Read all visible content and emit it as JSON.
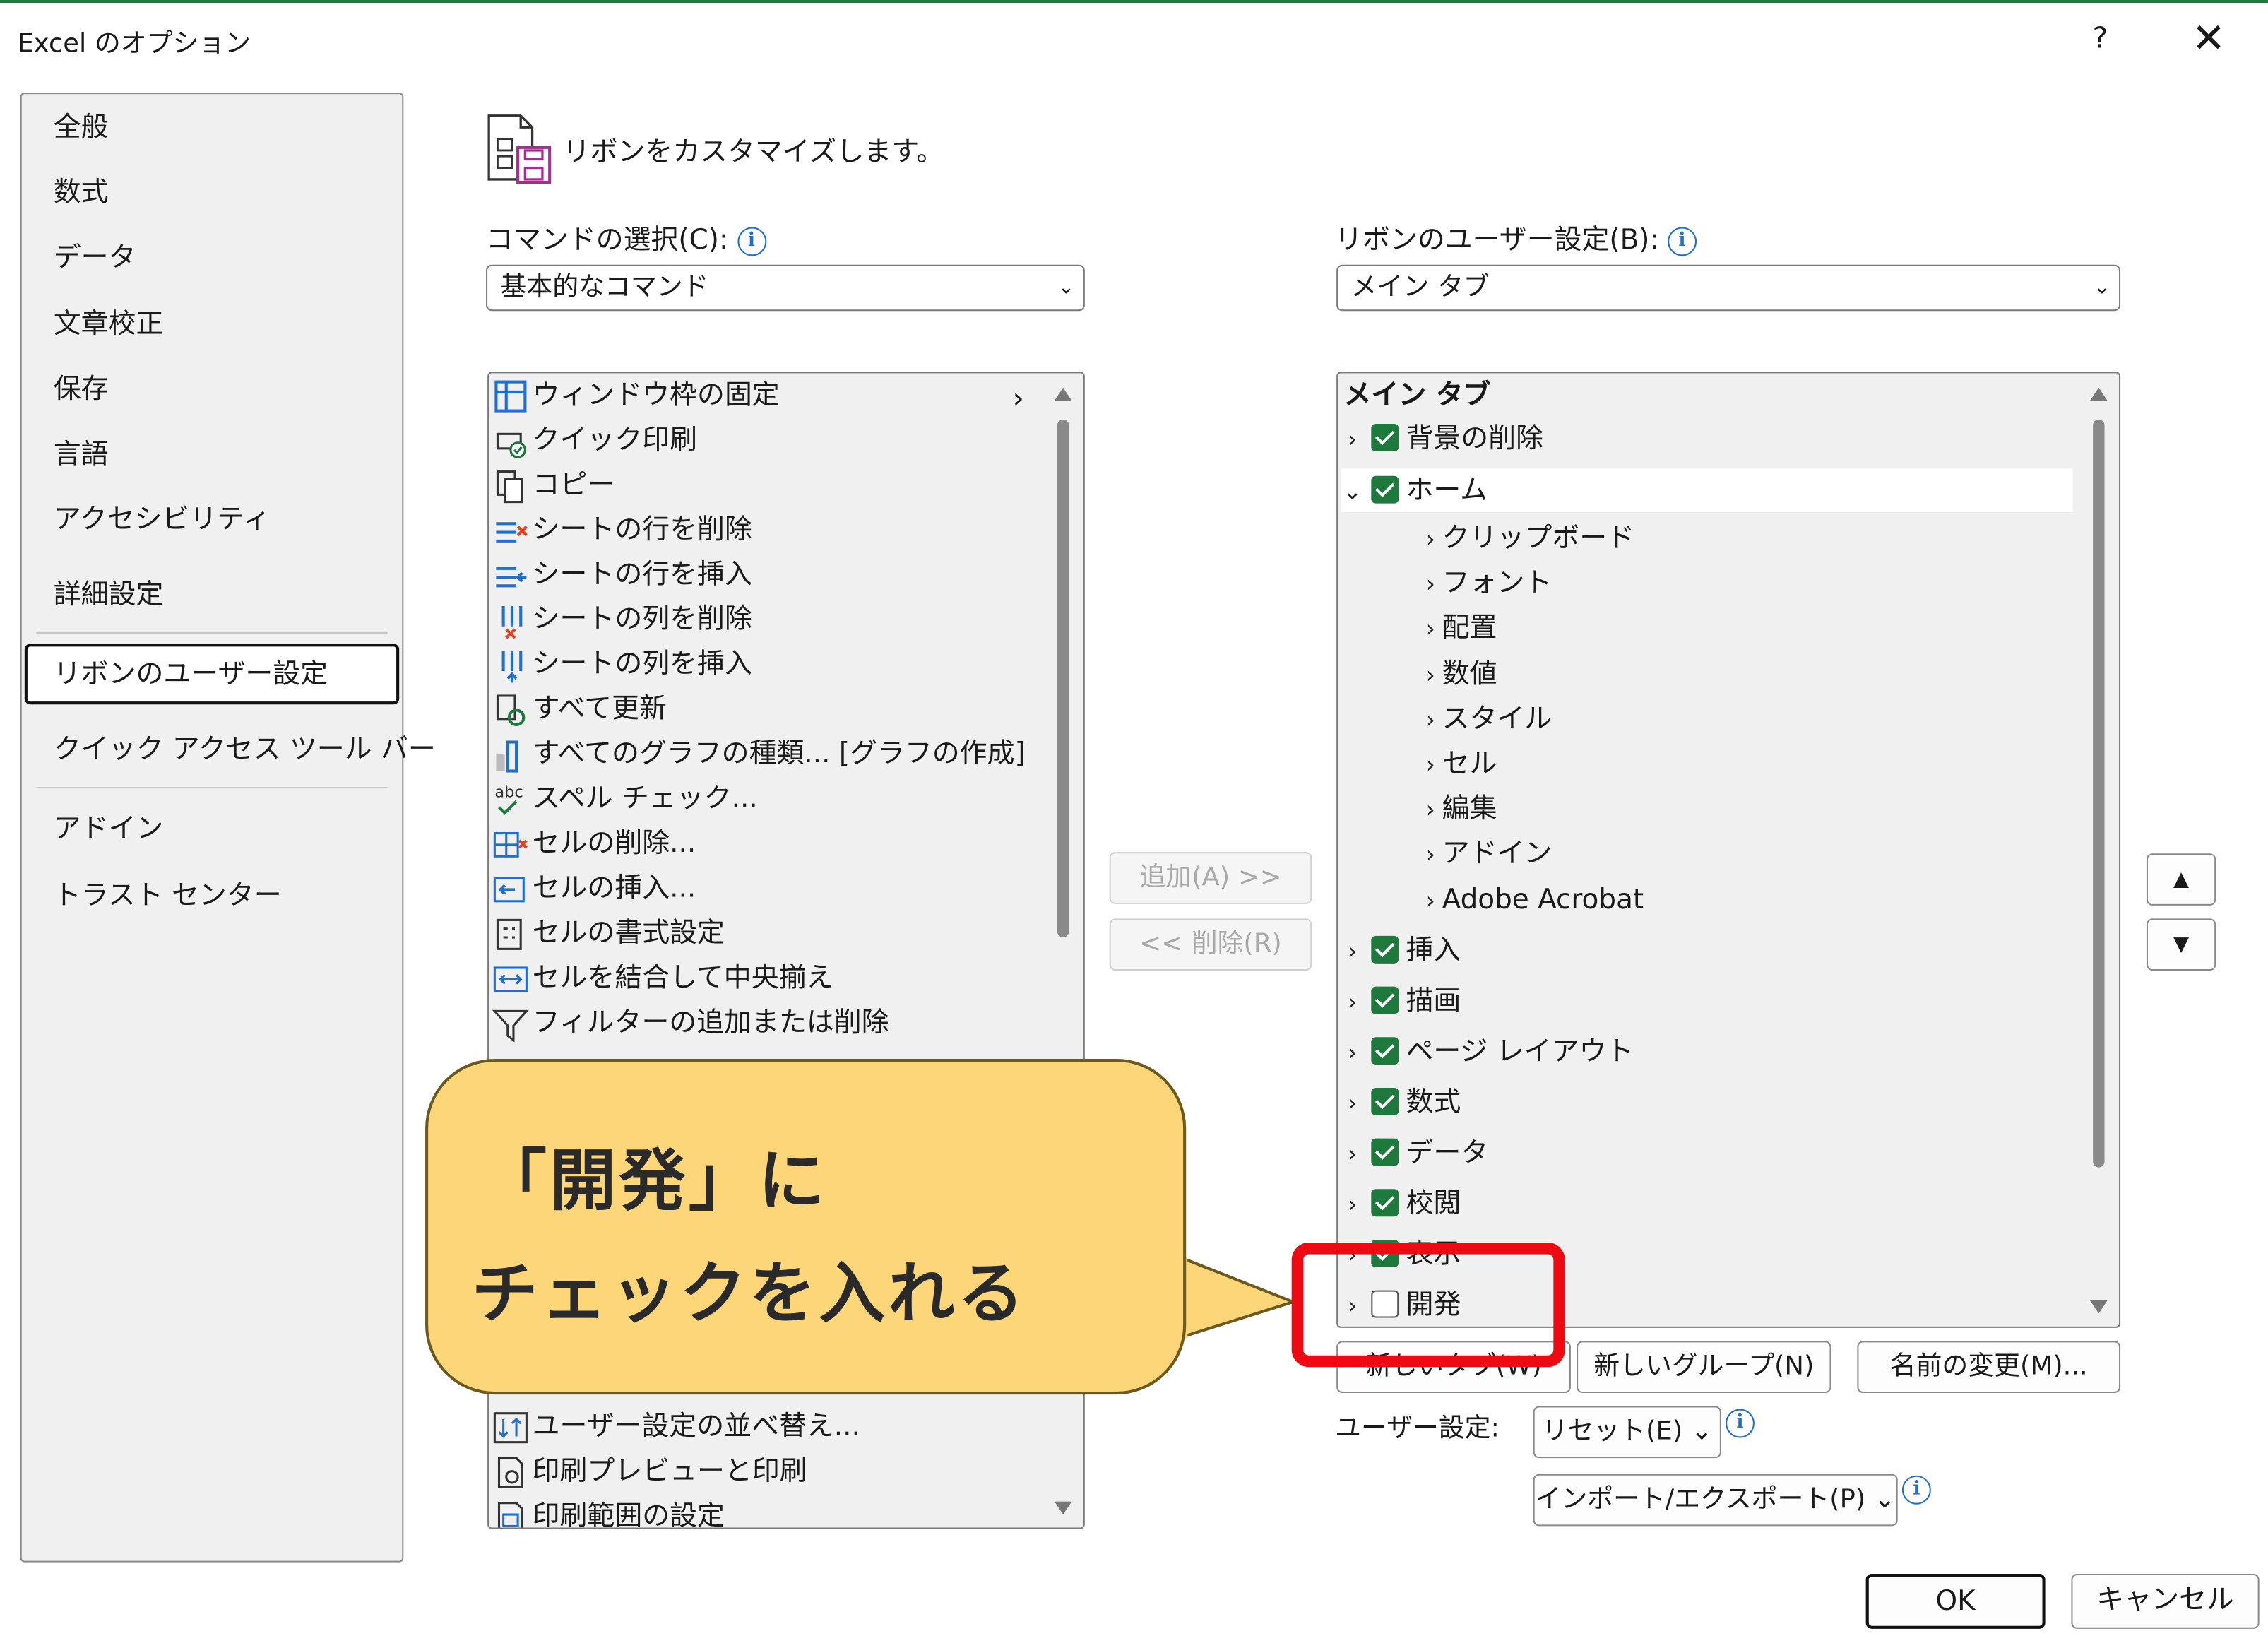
{
  "window": {
    "title": "Excel のオプション",
    "help": "?",
    "close": "✕"
  },
  "nav": {
    "items": [
      "全般",
      "数式",
      "データ",
      "文章校正",
      "保存",
      "言語",
      "アクセシビリティ",
      "詳細設定",
      "リボンのユーザー設定",
      "クイック アクセス ツール バー",
      "アドイン",
      "トラスト センター"
    ],
    "selected": "リボンのユーザー設定"
  },
  "header": {
    "title": "リボンをカスタマイズします。"
  },
  "commands": {
    "label": "コマンドの選択(C):",
    "selected": "基本的なコマンド",
    "items": [
      {
        "label": "ウィンドウ枠の固定",
        "icon": "freeze-panes-icon",
        "submenu": true
      },
      {
        "label": "クイック印刷",
        "icon": "quick-print-icon"
      },
      {
        "label": "コピー",
        "icon": "copy-icon"
      },
      {
        "label": "シートの行を削除",
        "icon": "delete-row-icon"
      },
      {
        "label": "シートの行を挿入",
        "icon": "insert-row-icon"
      },
      {
        "label": "シートの列を削除",
        "icon": "delete-column-icon"
      },
      {
        "label": "シートの列を挿入",
        "icon": "insert-column-icon"
      },
      {
        "label": "すべて更新",
        "icon": "refresh-all-icon"
      },
      {
        "label": "すべてのグラフの種類... [グラフの作成]",
        "icon": "chart-icon"
      },
      {
        "label": "スペル チェック...",
        "icon": "spelling-icon"
      },
      {
        "label": "セルの削除...",
        "icon": "delete-cells-icon"
      },
      {
        "label": "セルの挿入...",
        "icon": "insert-cells-icon"
      },
      {
        "label": "セルの書式設定",
        "icon": "format-cells-icon"
      },
      {
        "label": "セルを結合して中央揃え",
        "icon": "merge-center-icon"
      },
      {
        "label": "フィルターの追加または削除",
        "icon": "filter-icon"
      }
    ],
    "bottom_items": [
      {
        "label": "ユーザー設定の並べ替え...",
        "icon": "sort-icon"
      },
      {
        "label": "印刷プレビューと印刷",
        "icon": "print-preview-icon"
      },
      {
        "label": "印刷範囲の設定",
        "icon": "print-area-icon"
      }
    ]
  },
  "ribbon": {
    "label": "リボンのユーザー設定(B):",
    "selected": "メイン タブ",
    "tree_header": "メイン タブ",
    "tabs": [
      {
        "label": "背景の削除",
        "checked": true,
        "expanded": false
      },
      {
        "label": "ホーム",
        "checked": true,
        "expanded": true,
        "groups": [
          "クリップボード",
          "フォント",
          "配置",
          "数値",
          "スタイル",
          "セル",
          "編集",
          "アドイン",
          "Adobe Acrobat"
        ]
      },
      {
        "label": "挿入",
        "checked": true,
        "expanded": false
      },
      {
        "label": "描画",
        "checked": true,
        "expanded": false
      },
      {
        "label": "ページ レイアウト",
        "checked": true,
        "expanded": false
      },
      {
        "label": "数式",
        "checked": true,
        "expanded": false
      },
      {
        "label": "データ",
        "checked": true,
        "expanded": false
      },
      {
        "label": "校閲",
        "checked": true,
        "expanded": false
      },
      {
        "label": "表示",
        "checked": true,
        "expanded": false
      },
      {
        "label": "開発",
        "checked": false,
        "expanded": false
      }
    ]
  },
  "buttons": {
    "add": "追加(A) >>",
    "remove": "<< 削除(R)",
    "new_tab": "新しいタブ(W)",
    "new_group": "新しいグループ(N)",
    "rename": "名前の変更(M)...",
    "custom_label": "ユーザー設定:",
    "reset": "リセット(E) ⌄",
    "import_export": "インポート/エクスポート(P) ⌄",
    "ok": "OK",
    "cancel": "キャンセル",
    "move_up": "▲",
    "move_down": "▼"
  },
  "callout": {
    "line1": "「開発」に",
    "line2": "チェックを入れる"
  },
  "colors": {
    "accent_green": "#1e7a3c",
    "callout_fill": "#fdd67a",
    "highlight_red": "#ee0a12"
  }
}
